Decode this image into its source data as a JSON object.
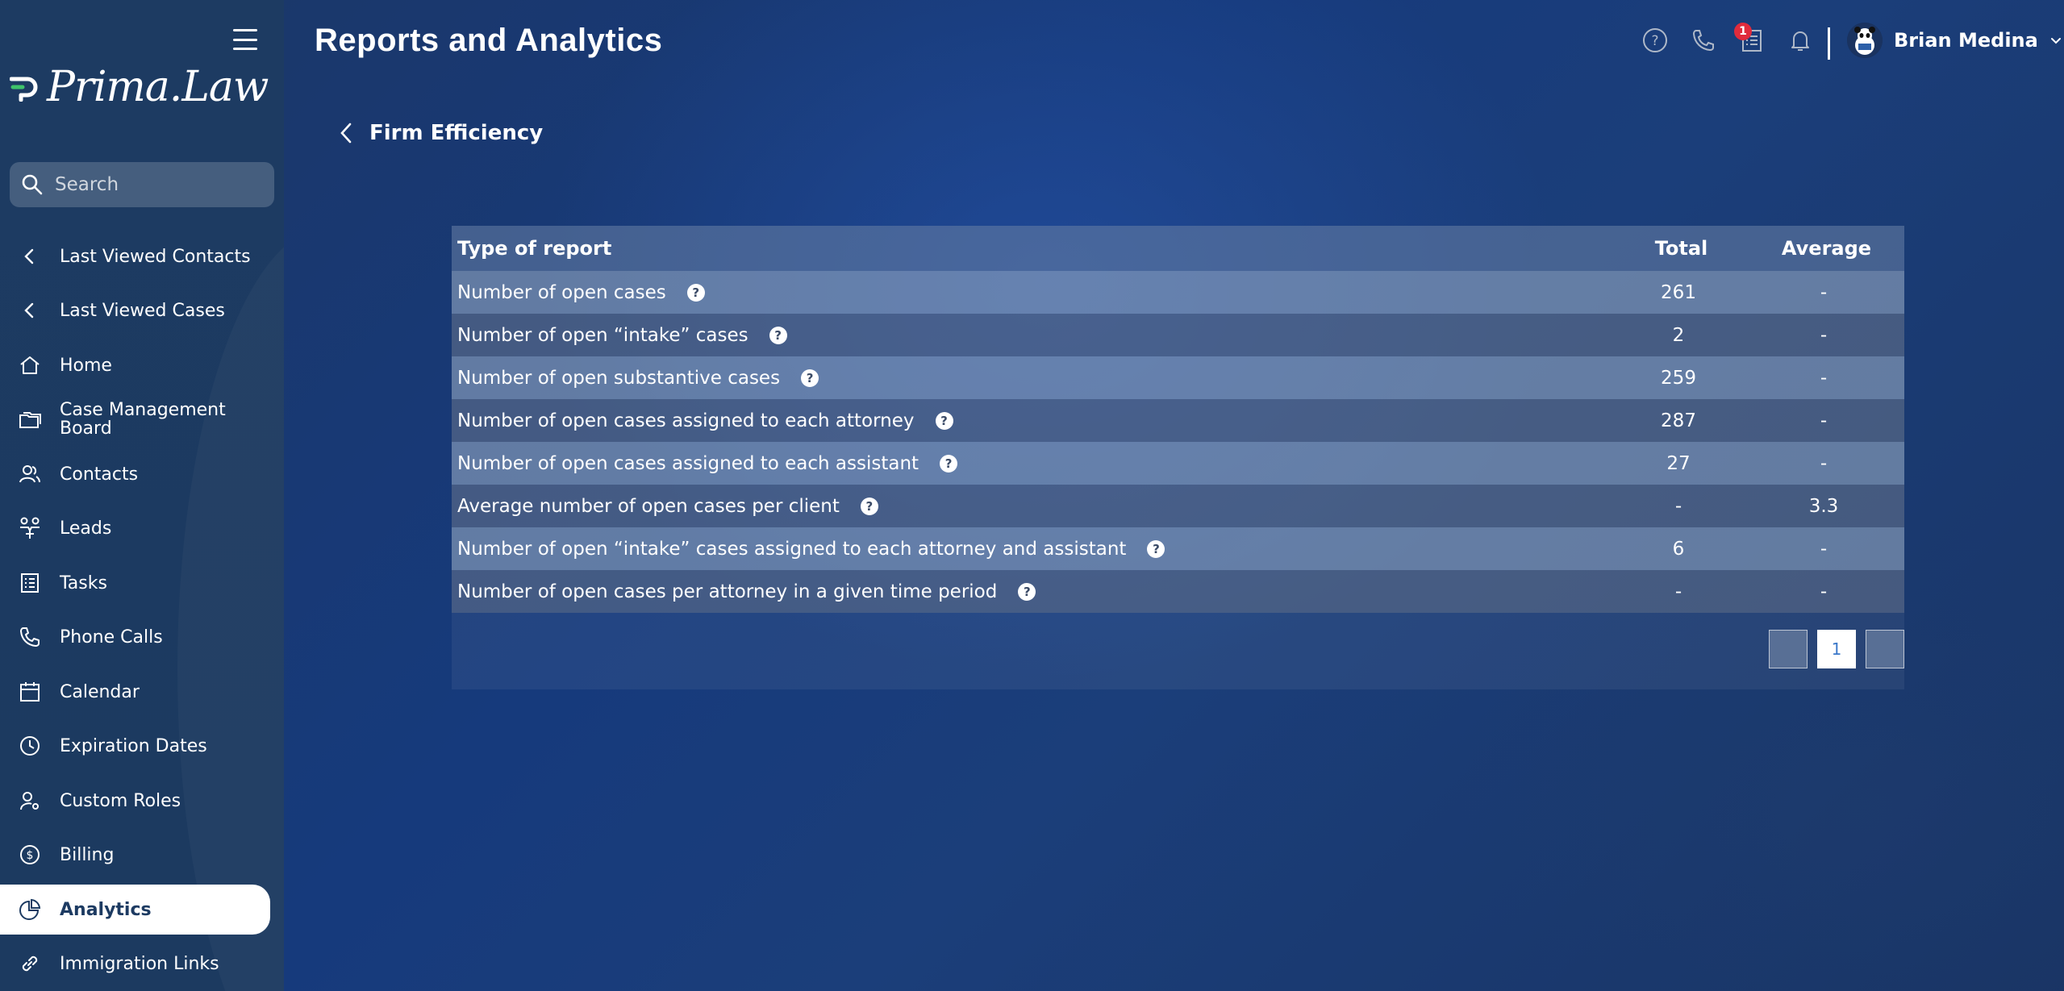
{
  "app": {
    "brand": "Prima.Law",
    "colors": {
      "accent_green": "#3fc46b",
      "sidebar_bg": "#1d3b62",
      "badge_red": "#e02b3c"
    }
  },
  "sidebar": {
    "search_placeholder": "Search",
    "items": [
      {
        "label": "Last Viewed Contacts",
        "icon": "chevron-left-icon"
      },
      {
        "label": "Last Viewed Cases",
        "icon": "chevron-left-icon"
      },
      {
        "label": "Home",
        "icon": "home-icon"
      },
      {
        "label": "Case Management Board",
        "icon": "folders-icon"
      },
      {
        "label": "Contacts",
        "icon": "contacts-icon"
      },
      {
        "label": "Leads",
        "icon": "leads-icon"
      },
      {
        "label": "Tasks",
        "icon": "tasks-icon"
      },
      {
        "label": "Phone Calls",
        "icon": "phone-icon"
      },
      {
        "label": "Calendar",
        "icon": "calendar-icon"
      },
      {
        "label": "Expiration Dates",
        "icon": "clock-icon"
      },
      {
        "label": "Custom Roles",
        "icon": "user-gear-icon"
      },
      {
        "label": "Billing",
        "icon": "dollar-icon"
      },
      {
        "label": "Analytics",
        "icon": "pie-chart-icon",
        "active": true
      },
      {
        "label": "Immigration Links",
        "icon": "link-icon"
      }
    ]
  },
  "header": {
    "title": "Reports and Analytics",
    "notification_count": "1",
    "user_name": "Brian Medina"
  },
  "breadcrumb": {
    "label": "Firm Efficiency"
  },
  "table": {
    "columns": [
      "Type of report",
      "Total",
      "Average"
    ],
    "rows": [
      {
        "type": "Number of open cases",
        "total": "261",
        "average": "-"
      },
      {
        "type": "Number of open “intake” cases",
        "total": "2",
        "average": "-"
      },
      {
        "type": "Number of open substantive cases",
        "total": "259",
        "average": "-"
      },
      {
        "type": "Number of open cases assigned to each attorney",
        "total": "287",
        "average": "-"
      },
      {
        "type": "Number of open cases assigned to each assistant",
        "total": "27",
        "average": "-"
      },
      {
        "type": "Average number of open cases per client",
        "total": "-",
        "average": "3.3"
      },
      {
        "type": "Number of open “intake” cases assigned to each attorney and assistant",
        "total": "6",
        "average": "-"
      },
      {
        "type": "Number of open cases per attorney in a given time period",
        "total": "-",
        "average": "-"
      }
    ],
    "help_glyph": "?"
  },
  "pagination": {
    "current_page": "1"
  }
}
